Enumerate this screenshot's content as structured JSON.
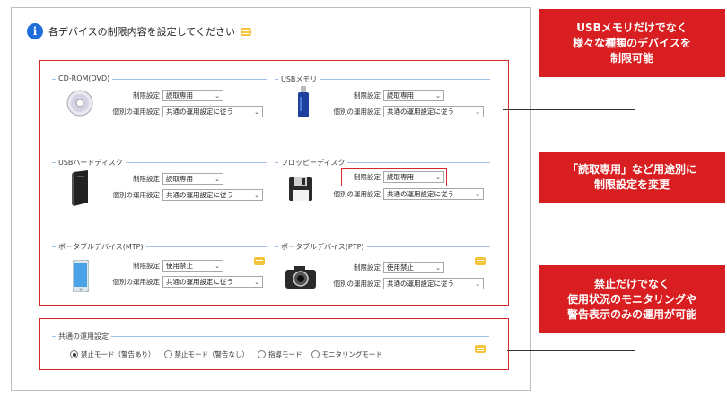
{
  "header": {
    "title": "各デバイスの制限内容を設定してください"
  },
  "devices": [
    {
      "name": "CD-ROM(DVD)",
      "icon": "cd-icon",
      "restriction_label": "制限設定",
      "restriction_value": "読取専用",
      "usage_label": "個別の運用設定",
      "usage_value": "共通の運用設定に従う"
    },
    {
      "name": "USBメモリ",
      "icon": "usb-memory-icon",
      "restriction_label": "制限設定",
      "restriction_value": "読取専用",
      "usage_label": "個別の運用設定",
      "usage_value": "共通の運用設定に従う"
    },
    {
      "name": "USBハードディスク",
      "icon": "hard-disk-icon",
      "restriction_label": "制限設定",
      "restriction_value": "読取専用",
      "usage_label": "個別の運用設定",
      "usage_value": "共通の運用設定に従う"
    },
    {
      "name": "フロッピーディスク",
      "icon": "floppy-icon",
      "restriction_label": "制限設定",
      "restriction_value": "読取専用",
      "usage_label": "個別の運用設定",
      "usage_value": "共通の運用設定に従う"
    },
    {
      "name": "ポータブルデバイス(MTP)",
      "icon": "smartphone-icon",
      "restriction_label": "制限設定",
      "restriction_value": "使用禁止",
      "usage_label": "個別の運用設定",
      "usage_value": "共通の運用設定に従う"
    },
    {
      "name": "ポータブルデバイス(PTP)",
      "icon": "camera-icon",
      "restriction_label": "制限設定",
      "restriction_value": "使用禁止",
      "usage_label": "個別の運用設定",
      "usage_value": "共通の運用設定に従う"
    }
  ],
  "common": {
    "title": "共通の運用設定",
    "options": [
      "禁止モード（警告あり）",
      "禁止モード（警告なし）",
      "指導モード",
      "モニタリングモード"
    ],
    "selected": 0
  },
  "callouts": [
    {
      "lines": [
        "USBメモリだけでなく",
        "様々な種類のデバイスを",
        "制限可能"
      ]
    },
    {
      "lines": [
        "「読取専用」など用途別に",
        "制限設定を変更"
      ]
    },
    {
      "lines": [
        "禁止だけでなく",
        "使用状況のモニタリングや",
        "警告表示のみの運用が可能"
      ]
    }
  ],
  "colors": {
    "accent": "#d81e20",
    "info": "#1e6fd9",
    "note": "#f4c43a",
    "group_line": "#9fc0e8"
  }
}
